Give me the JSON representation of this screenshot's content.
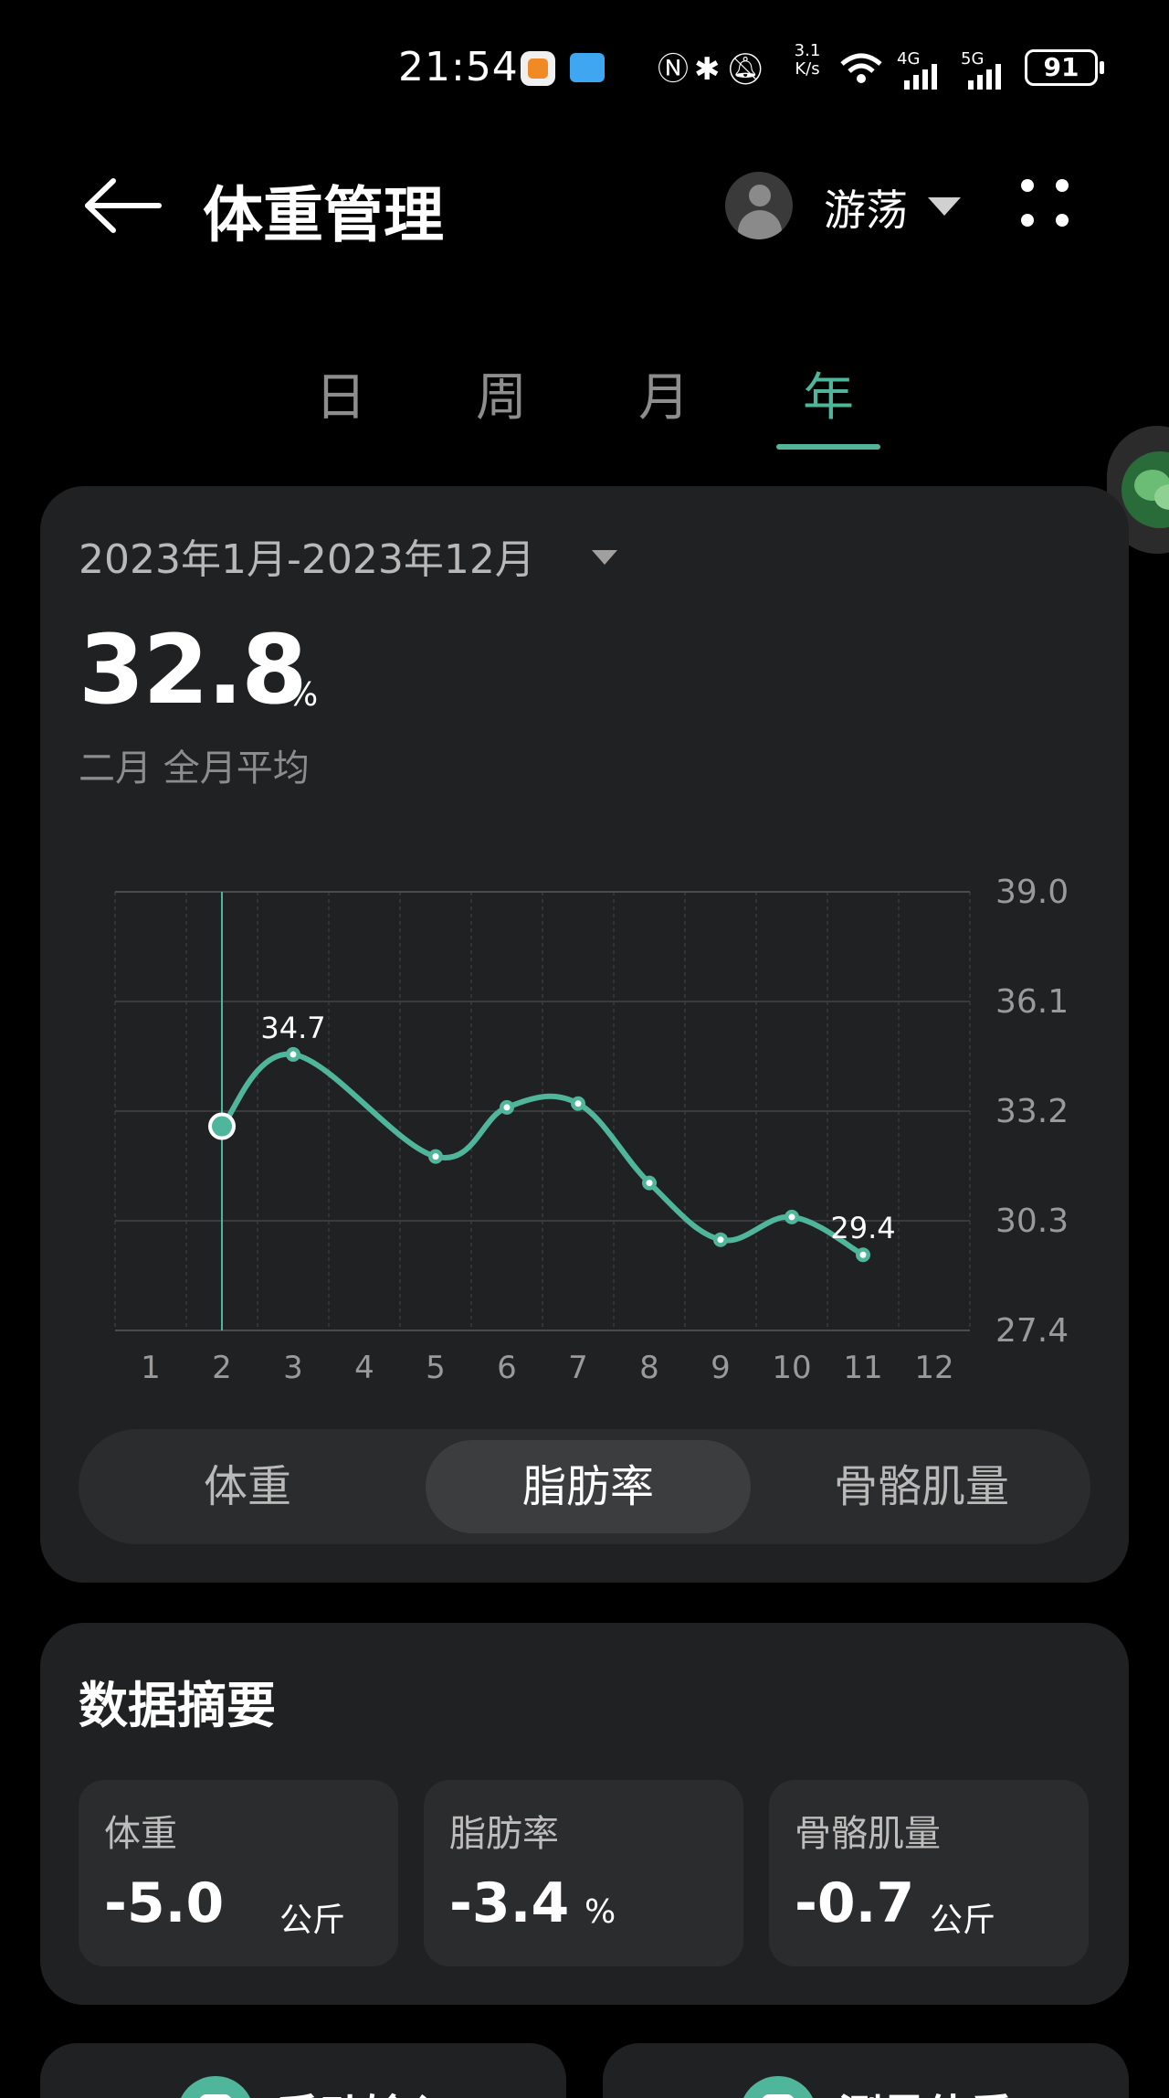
{
  "status": {
    "time": "21:54",
    "net_speed_value": "3.1",
    "net_speed_unit": "K/s",
    "net_4g": "4G",
    "net_5g": "5G",
    "battery": "91"
  },
  "header": {
    "title": "体重管理",
    "user_name": "游荡"
  },
  "tabs": [
    {
      "label": "日",
      "active": false
    },
    {
      "label": "周",
      "active": false
    },
    {
      "label": "月",
      "active": false
    },
    {
      "label": "年",
      "active": true
    }
  ],
  "summary": {
    "date_range": "2023年1月-2023年12月",
    "value": "32.8",
    "unit": "%",
    "sub_label": "二月  全月平均"
  },
  "metric_tabs": [
    {
      "label": "体重",
      "active": false
    },
    {
      "label": "脂肪率",
      "active": true
    },
    {
      "label": "骨骼肌量",
      "active": false
    }
  ],
  "chart_data": {
    "type": "line",
    "x": [
      1,
      2,
      3,
      4,
      5,
      6,
      7,
      8,
      9,
      10,
      11,
      12
    ],
    "series": [
      {
        "values": [
          null,
          32.8,
          34.7,
          null,
          32.0,
          33.3,
          33.4,
          31.3,
          29.8,
          30.4,
          29.4,
          null
        ]
      }
    ],
    "y_ticks": [
      "39.0",
      "36.1",
      "33.2",
      "30.3",
      "27.4"
    ],
    "x_ticks": [
      "1",
      "2",
      "3",
      "4",
      "5",
      "6",
      "7",
      "8",
      "9",
      "10",
      "11",
      "12"
    ],
    "ylim": [
      27.4,
      39.0
    ],
    "annotations": [
      {
        "x": 3,
        "label": "34.7"
      },
      {
        "x": 11,
        "label": "29.4"
      }
    ],
    "selected_x": 2,
    "grid": true,
    "line_color": "#4fb59b"
  },
  "data_summary": {
    "heading": "数据摘要",
    "items": [
      {
        "label": "体重",
        "value": "-5.0",
        "unit": "公斤"
      },
      {
        "label": "脂肪率",
        "value": "-3.4",
        "unit": "%"
      },
      {
        "label": "骨骼肌量",
        "value": "-0.7",
        "unit": "公斤"
      }
    ]
  },
  "actions": [
    {
      "label": "手动输入"
    },
    {
      "label": "测量体重"
    }
  ],
  "colors": {
    "accent": "#4fb59b",
    "card_bg": "#202122",
    "background": "#000000"
  }
}
